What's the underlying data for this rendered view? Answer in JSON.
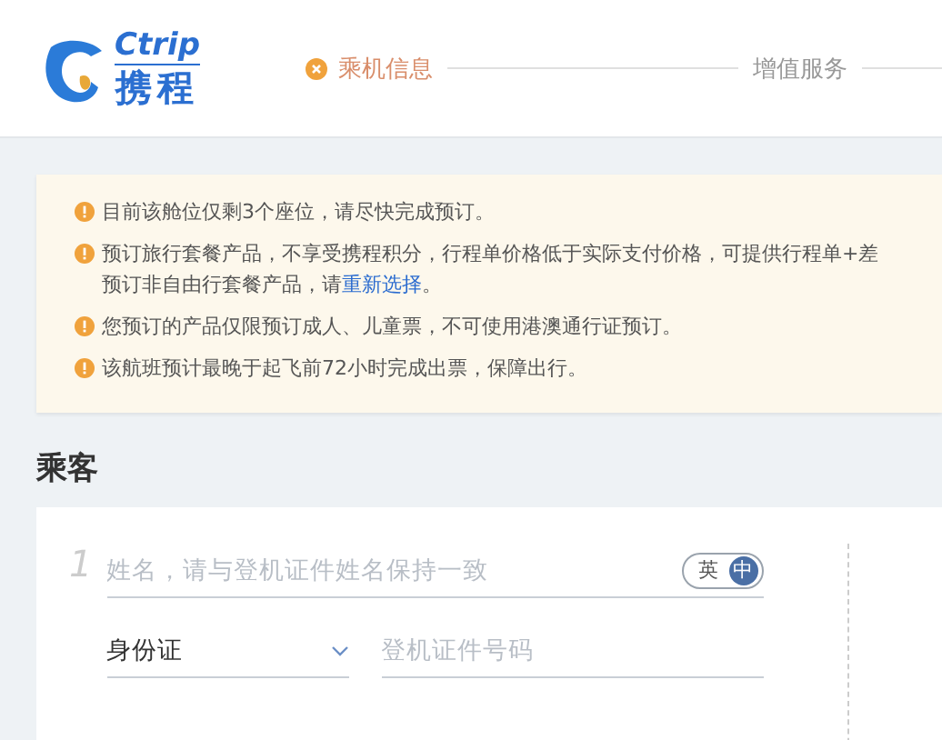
{
  "header": {
    "logo": {
      "brand_en": "Ctrip",
      "brand_cn": "携程"
    },
    "steps": [
      {
        "label": "乘机信息",
        "selected": true
      },
      {
        "label": "增值服务",
        "selected": false
      }
    ]
  },
  "notices": [
    {
      "text": "目前该舱位仅剩3个座位，请尽快完成预订。"
    },
    {
      "text": "预订旅行套餐产品，不享受携程积分，行程单价格低于实际支付价格，可提供行程单+差",
      "continuation": "预订非自由行套餐产品，请",
      "link": "重新选择",
      "after": "。"
    },
    {
      "text": "您预订的产品仅限预订成人、儿童票，不可使用港澳通行证预订。"
    },
    {
      "text": "该航班预计最晚于起飞前72小时完成出票，保障出行。"
    }
  ],
  "passengers": {
    "title": "乘客",
    "items": [
      {
        "number": "1",
        "name_field": {
          "placeholder": "姓名，请与登机证件姓名保持一致"
        },
        "name_lang": [
          {
            "label": "英",
            "selected": false
          },
          {
            "label": "中",
            "selected": true
          }
        ],
        "id_type": {
          "value": "身份证"
        },
        "id_number": {
          "placeholder": "登机证件号码"
        }
      }
    ]
  }
}
